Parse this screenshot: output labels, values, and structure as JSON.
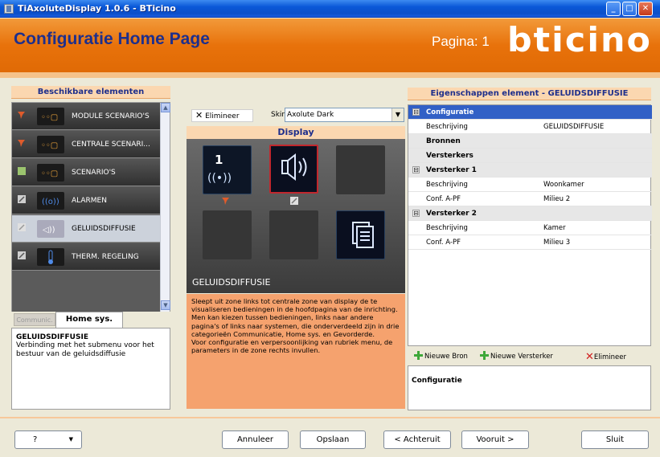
{
  "window": {
    "title": "TiAxoluteDisplay 1.0.6 - BTicino"
  },
  "header": {
    "title": "Configuratie Home Page",
    "pagina_label": "Pagina: 1",
    "logo_text": "bticino"
  },
  "left_panel": {
    "title": "Beschikbare elementen",
    "items": [
      {
        "label": "MODULE SCENARIO'S",
        "icon": "scenario-module-icon",
        "selected": false
      },
      {
        "label": "CENTRALE SCENARI...",
        "icon": "central-scenario-icon",
        "selected": false
      },
      {
        "label": "SCENARIO'S",
        "icon": "scenario-icon",
        "selected": false
      },
      {
        "label": "ALARMEN",
        "icon": "alarm-icon",
        "selected": false
      },
      {
        "label": "GELUIDSDIFFUSIE",
        "icon": "speaker-icon",
        "selected": true
      },
      {
        "label": "THERM. REGELING",
        "icon": "thermometer-icon",
        "selected": false
      }
    ],
    "tabs": [
      {
        "label": "Communic."
      },
      {
        "label": "Home sys."
      }
    ],
    "active_tab": "Home sys.",
    "description_title": "GELUIDSDIFFUSIE",
    "description_text": "Verbinding met het submenu voor het bestuur van de geluidsdiffusie"
  },
  "center_panel": {
    "eliminate_label": "Elimineer",
    "skin_label": "Skir",
    "skin_value": "Axolute Dark",
    "display_title": "Display",
    "display_label": "GELUIDSDIFFUSIE",
    "slot1_number": "1",
    "info_text": "Sleept uit zone links tot centrale zone van display de te visualiseren bedieningen in de hoofdpagina van de inrichting.\nMen kan kiezen tussen bedieningen, links naar andere pagina's of links naar systemen, die onderverdeeld zijn in drie categorieën Communicatie, Home sys. en Gevorderde.\nVoor configuratie en verpersoonlijking van rubriek menu, de parameters in de zone rechts invullen."
  },
  "right_panel": {
    "title": "Eigenschappen element - GELUIDSDIFFUSIE",
    "rows": [
      {
        "key": "Configuratie",
        "value": "",
        "type": "selected",
        "expander": "⊟"
      },
      {
        "key": "Beschrijving",
        "value": "GELUIDSDIFFUSIE",
        "type": "prop"
      },
      {
        "key": "Bronnen",
        "value": "",
        "type": "cat"
      },
      {
        "key": "Versterkers",
        "value": "",
        "type": "cat"
      },
      {
        "key": "Versterker 1",
        "value": "",
        "type": "cat",
        "expander": "⊟"
      },
      {
        "key": "Beschrijving",
        "value": "Woonkamer",
        "type": "prop"
      },
      {
        "key": "Conf. A-PF",
        "value": "Milieu 2",
        "type": "prop"
      },
      {
        "key": "Versterker 2",
        "value": "",
        "type": "cat",
        "expander": "⊟"
      },
      {
        "key": "Beschrijving",
        "value": "Kamer",
        "type": "prop"
      },
      {
        "key": "Conf. A-PF",
        "value": "Milieu 3",
        "type": "prop"
      }
    ],
    "actions": {
      "new_source": "Nieuwe Bron",
      "new_amp": "Nieuwe Versterker",
      "eliminate": "Elimineer"
    },
    "bottom_title": "Configuratie"
  },
  "footer": {
    "help": "?",
    "cancel": "Annuleer",
    "save": "Opslaan",
    "back": "< Achteruit",
    "forward": "Vooruit >",
    "close": "Sluit"
  },
  "colors": {
    "header_orange": "#e8720b",
    "title_blue": "#1e2f8c",
    "selection_blue": "#3160c6",
    "info_orange": "#f5a26e"
  }
}
